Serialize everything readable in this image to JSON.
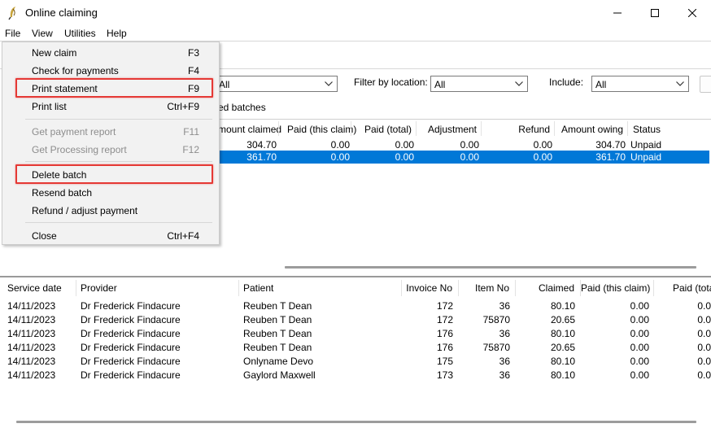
{
  "window": {
    "title": "Online claiming"
  },
  "menubar": {
    "items": [
      "File",
      "View",
      "Utilities",
      "Help"
    ]
  },
  "file_menu": {
    "items": [
      {
        "label": "New claim",
        "shortcut": "F3",
        "enabled": true
      },
      {
        "label": "Check for payments",
        "shortcut": "F4",
        "enabled": true
      },
      {
        "label": "Print statement",
        "shortcut": "F9",
        "enabled": true,
        "highlighted": true
      },
      {
        "label": "Print list",
        "shortcut": "Ctrl+F9",
        "enabled": true
      },
      {
        "label": "Get payment report",
        "shortcut": "F11",
        "enabled": false
      },
      {
        "label": "Get Processing report",
        "shortcut": "F12",
        "enabled": false
      },
      {
        "label": "Delete batch",
        "shortcut": "",
        "enabled": true,
        "highlighted": true
      },
      {
        "label": "Resend batch",
        "shortcut": "",
        "enabled": true
      },
      {
        "label": "Refund / adjust payment",
        "shortcut": "",
        "enabled": true
      },
      {
        "label": "Close",
        "shortcut": "Ctrl+F4",
        "enabled": true
      }
    ]
  },
  "filters": {
    "first_value": "All",
    "location_label": "Filter by location:",
    "location_value": "All",
    "include_label": "Include:",
    "include_value": "All",
    "batches_label_fragment": "ed batches"
  },
  "batch_grid": {
    "columns": [
      "mount claimed",
      "Paid (this claim)",
      "Paid (total)",
      "Adjustment",
      "Refund",
      "Amount owing",
      "Status"
    ],
    "rows": [
      {
        "amount_claimed": "304.70",
        "paid_this": "0.00",
        "paid_total": "0.00",
        "adjustment": "0.00",
        "refund": "0.00",
        "owing": "304.70",
        "status": "Unpaid",
        "selected": false
      },
      {
        "amount_claimed": "361.70",
        "paid_this": "0.00",
        "paid_total": "0.00",
        "adjustment": "0.00",
        "refund": "0.00",
        "owing": "361.70",
        "status": "Unpaid",
        "selected": true
      }
    ]
  },
  "detail_grid": {
    "columns": [
      "Service date",
      "Provider",
      "Patient",
      "Invoice No",
      "Item No",
      "Claimed",
      "Paid (this claim)",
      "Paid (tota"
    ],
    "rows": [
      {
        "date": "14/11/2023",
        "provider": "Dr Frederick Findacure",
        "patient": "Reuben T Dean",
        "invoice": "172",
        "item": "36",
        "claimed": "80.10",
        "paid_this": "0.00",
        "paid_total": "0.0"
      },
      {
        "date": "14/11/2023",
        "provider": "Dr Frederick Findacure",
        "patient": "Reuben T Dean",
        "invoice": "172",
        "item": "75870",
        "claimed": "20.65",
        "paid_this": "0.00",
        "paid_total": "0.0"
      },
      {
        "date": "14/11/2023",
        "provider": "Dr Frederick Findacure",
        "patient": "Reuben T Dean",
        "invoice": "176",
        "item": "36",
        "claimed": "80.10",
        "paid_this": "0.00",
        "paid_total": "0.0"
      },
      {
        "date": "14/11/2023",
        "provider": "Dr Frederick Findacure",
        "patient": "Reuben T Dean",
        "invoice": "176",
        "item": "75870",
        "claimed": "20.65",
        "paid_this": "0.00",
        "paid_total": "0.0"
      },
      {
        "date": "14/11/2023",
        "provider": "Dr Frederick Findacure",
        "patient": "Onlyname Devo",
        "invoice": "175",
        "item": "36",
        "claimed": "80.10",
        "paid_this": "0.00",
        "paid_total": "0.0"
      },
      {
        "date": "14/11/2023",
        "provider": "Dr Frederick Findacure",
        "patient": "Gaylord Maxwell",
        "invoice": "173",
        "item": "36",
        "claimed": "80.10",
        "paid_this": "0.00",
        "paid_total": "0.0"
      }
    ]
  },
  "colors": {
    "selection": "#0078d7",
    "highlight_box": "#e53935",
    "disabled_text": "#8d8d8d"
  },
  "icons": {
    "app": "feather-quill-icon",
    "minimize": "minimize-icon",
    "maximize": "maximize-icon",
    "close": "close-icon",
    "dropdown": "chevron-down-icon"
  }
}
